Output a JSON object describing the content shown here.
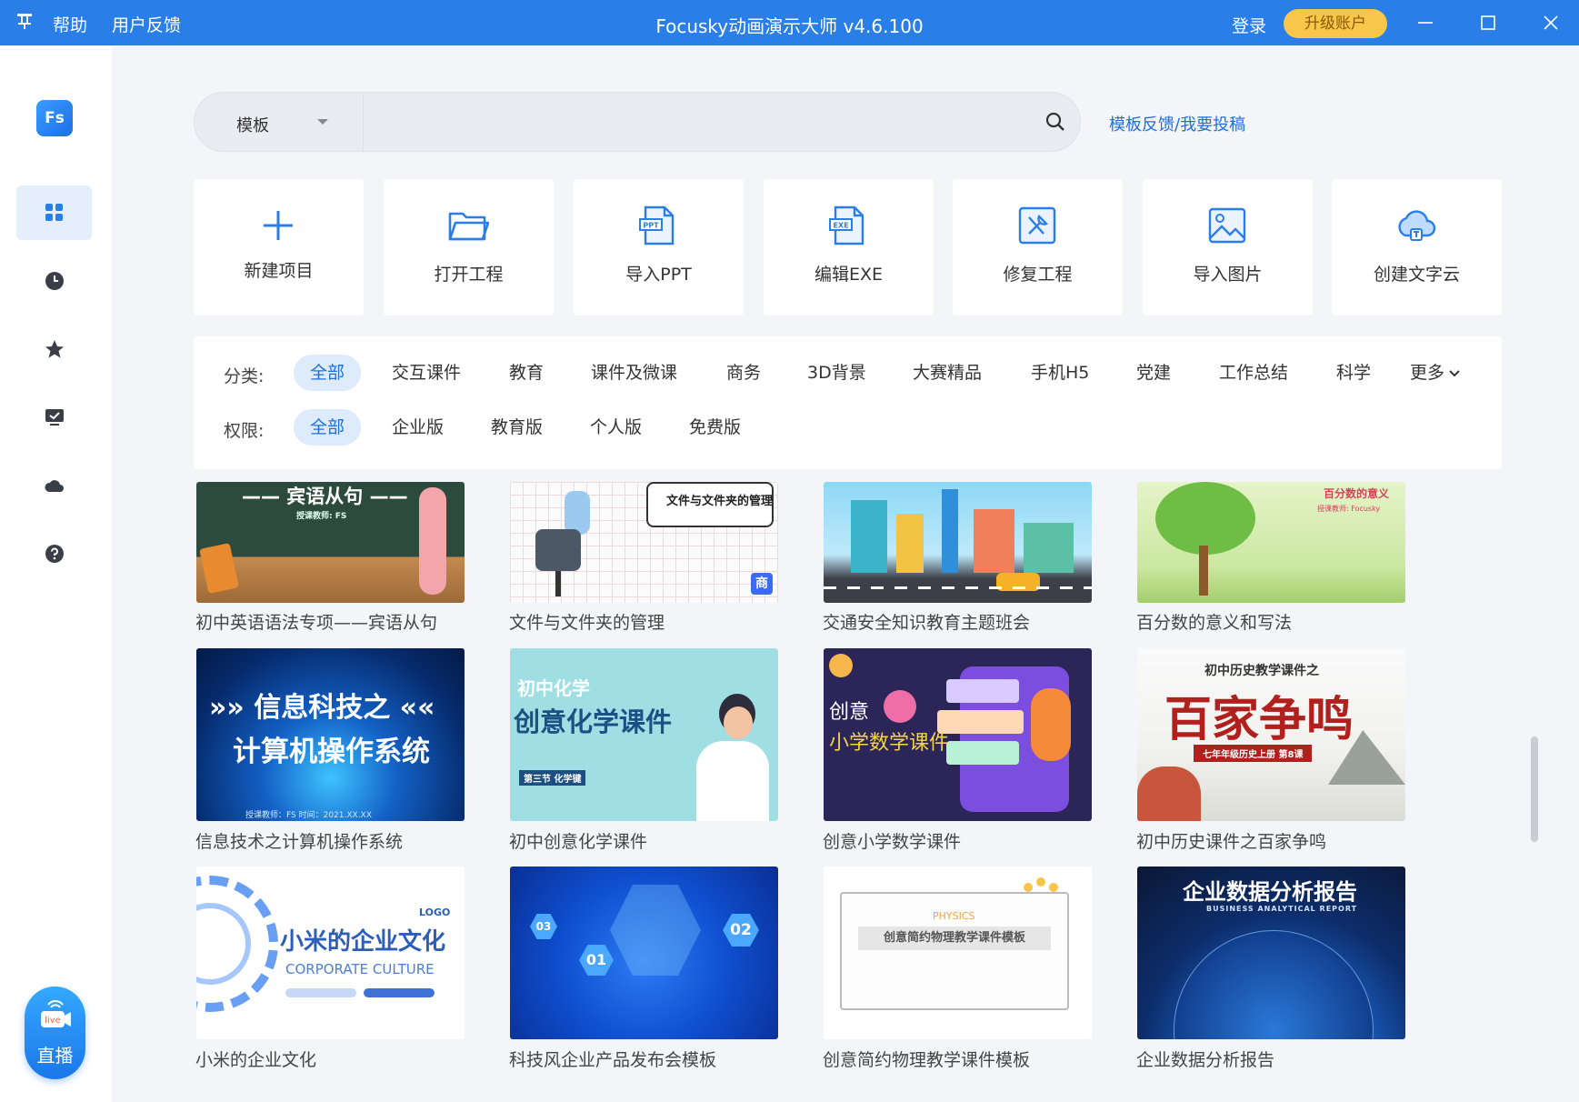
{
  "titlebar": {
    "help": "帮助",
    "feedback": "用户反馈",
    "title": "Focusky动画演示大师 v4.6.100",
    "login": "登录",
    "upgrade": "升级账户"
  },
  "sidebar": {
    "logo": "Fs",
    "items": [
      {
        "name": "templates",
        "icon": "grid-icon"
      },
      {
        "name": "recent",
        "icon": "clock-icon"
      },
      {
        "name": "favorites",
        "icon": "star-icon"
      },
      {
        "name": "tasks",
        "icon": "check-monitor-icon"
      },
      {
        "name": "cloud",
        "icon": "cloud-icon"
      },
      {
        "name": "help",
        "icon": "question-icon"
      }
    ],
    "live_badge": "live",
    "live_label": "直播"
  },
  "search": {
    "dropdown": "模板",
    "placeholder": "",
    "feedback_link": "模板反馈/我要投稿"
  },
  "actions": [
    {
      "label": "新建项目",
      "icon": "plus-icon"
    },
    {
      "label": "打开工程",
      "icon": "folder-icon"
    },
    {
      "label": "导入PPT",
      "icon": "ppt-file-icon",
      "badge": "PPT"
    },
    {
      "label": "编辑EXE",
      "icon": "exe-file-icon",
      "badge": "EXE"
    },
    {
      "label": "修复工程",
      "icon": "repair-icon"
    },
    {
      "label": "导入图片",
      "icon": "image-icon"
    },
    {
      "label": "创建文字云",
      "icon": "word-cloud-icon"
    }
  ],
  "filters": {
    "category_label": "分类:",
    "categories": [
      "全部",
      "交互课件",
      "教育",
      "课件及微课",
      "商务",
      "3D背景",
      "大赛精品",
      "手机H5",
      "党建",
      "工作总结",
      "科学",
      "更多"
    ],
    "permission_label": "权限:",
    "permissions": [
      "全部",
      "企业版",
      "教育版",
      "个人版",
      "免费版"
    ]
  },
  "templates": [
    {
      "title": "初中英语语法专项——宾语从句",
      "thumb_text": "—— 宾语从句 ——",
      "thumb_sub": "授课教师: FS"
    },
    {
      "title": "文件与文件夹的管理",
      "thumb_text": "文件与文件夹的管理",
      "badge": "商"
    },
    {
      "title": "交通安全知识教育主题班会",
      "thumb_text": ""
    },
    {
      "title": "百分数的意义和写法",
      "thumb_text": "百分数的意义",
      "thumb_sub": "授课教师: Focusky"
    },
    {
      "title": "信息技术之计算机操作系统",
      "thumb_text": "»» 信息科技之 ««",
      "thumb_text2": "计算机操作系统",
      "thumb_sub": "授课教师：FS    时间：2021.XX.XX"
    },
    {
      "title": "初中创意化学课件",
      "thumb_text": "初中化学",
      "thumb_text2": "创意化学课件",
      "thumb_sub": "第三节 化学键"
    },
    {
      "title": "创意小学数学课件",
      "thumb_text": "创意",
      "thumb_text2": "小学数学课件"
    },
    {
      "title": "初中历史课件之百家争鸣",
      "thumb_text": "初中历史教学课件之",
      "thumb_text2": "百家争鸣",
      "thumb_sub": "七年年级历史上册 第8课"
    },
    {
      "title": "小米的企业文化",
      "thumb_text": "小米的企业文化",
      "thumb_text2": "CORPORATE CULTURE",
      "thumb_sub": "LOGO"
    },
    {
      "title": "科技风企业产品发布会模板",
      "thumb_text": "01",
      "thumb_text2": "02",
      "thumb_sub": "03"
    },
    {
      "title": "创意简约物理教学课件模板",
      "thumb_text": "PHYSICS",
      "thumb_text2": "创意简约物理教学课件模板"
    },
    {
      "title": "企业数据分析报告",
      "thumb_text": "企业数据分析报告",
      "thumb_sub": "BUSINESS ANALYTICAL REPORT"
    }
  ],
  "colors": {
    "titlebar": "#2a7ee8",
    "accent": "#1f6fe0",
    "upgrade": "#f7c64a",
    "selected_chip_bg": "#ddebfb"
  }
}
